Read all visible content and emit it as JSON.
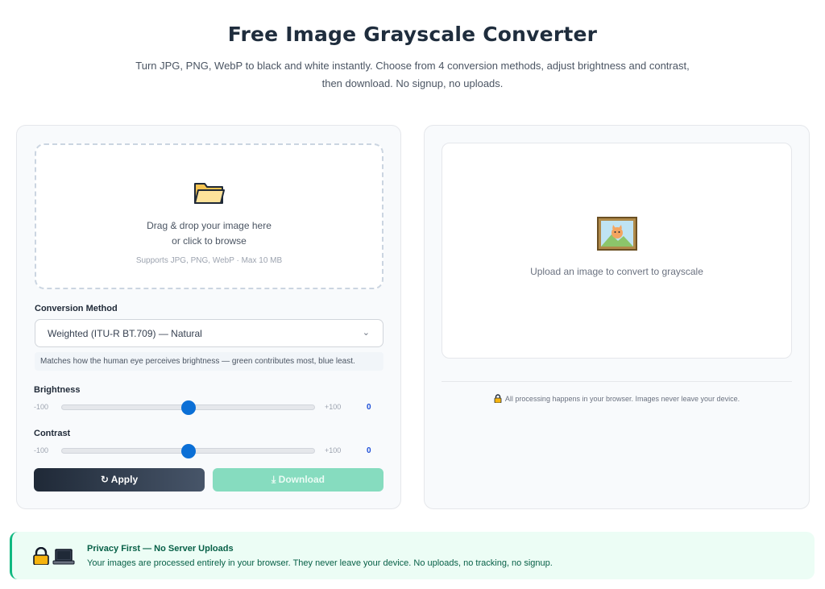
{
  "header": {
    "title": "Free Image Grayscale Converter",
    "subtitle": "Turn JPG, PNG, WebP to black and white instantly. Choose from 4 conversion methods, adjust brightness and contrast, then download. No signup, no uploads."
  },
  "upload": {
    "line1": "Drag & drop your image here",
    "line2": "or click to browse",
    "hint": "Supports JPG, PNG, WebP · Max 10 MB",
    "icon": "folder-icon"
  },
  "method": {
    "label": "Conversion Method",
    "selected": "Weighted (ITU-R BT.709) — Natural",
    "description": "Matches how the human eye perceives brightness — green contributes most, blue least."
  },
  "brightness": {
    "label": "Brightness",
    "min": "-100",
    "max": "+100",
    "value": "0",
    "level": 0.5
  },
  "contrast": {
    "label": "Contrast",
    "min": "-100",
    "max": "+100",
    "value": "0",
    "level": 0.5
  },
  "buttons": {
    "apply": "Apply",
    "download": "Download"
  },
  "preview": {
    "placeholder": "Upload an image to convert to grayscale",
    "note": "All processing happens in your browser. Images never leave your device."
  },
  "privacy": {
    "title": "Privacy First — No Server Uploads",
    "text": "Your images are processed entirely in your browser. They never leave your device. No uploads, no tracking, no signup."
  },
  "colors": {
    "accent": "#0b6fd6",
    "apply_bg": "#1f2937",
    "download_bg": "#86dcbf",
    "banner_border": "#10b981"
  }
}
